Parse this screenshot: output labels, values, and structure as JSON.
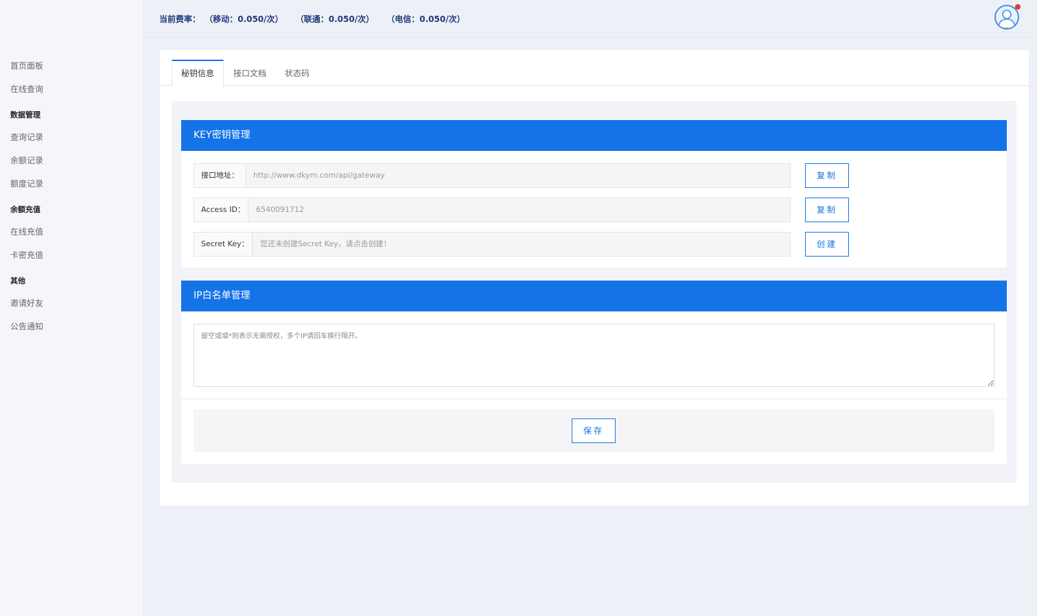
{
  "sidebar": {
    "items": [
      {
        "type": "item",
        "label": "首页面板"
      },
      {
        "type": "item",
        "label": "在线查询"
      },
      {
        "type": "group",
        "label": "数据管理"
      },
      {
        "type": "item",
        "label": "查询记录"
      },
      {
        "type": "item",
        "label": "余额记录"
      },
      {
        "type": "item",
        "label": "额度记录"
      },
      {
        "type": "group",
        "label": "余额充值"
      },
      {
        "type": "item",
        "label": "在线充值"
      },
      {
        "type": "item",
        "label": "卡密充值"
      },
      {
        "type": "group",
        "label": "其他"
      },
      {
        "type": "item",
        "label": "邀请好友"
      },
      {
        "type": "item",
        "label": "公告通知"
      }
    ]
  },
  "header": {
    "rate_title": "当前费率：",
    "rate_mobile": "（移动：0.050/次）",
    "rate_unicom": "（联通：0.050/次）",
    "rate_telecom": "（电信：0.050/次）",
    "avatar_icon": "user-avatar-icon",
    "notification_color": "#e53935"
  },
  "tabs": [
    {
      "label": "秘钥信息",
      "active": true
    },
    {
      "label": "接口文档",
      "active": false
    },
    {
      "label": "状态码",
      "active": false
    }
  ],
  "key_panel": {
    "title": "KEY密钥管理",
    "fields": [
      {
        "label": "接口地址：",
        "value": "http://www.dkym.com/api/gateway",
        "button": "复制"
      },
      {
        "label": "Access ID：",
        "value": "6540091712",
        "button": "复制"
      },
      {
        "label": "Secret Key：",
        "value": "您还未创建Secret Key，请点击创建！",
        "button": "创建"
      }
    ]
  },
  "ip_panel": {
    "title": "IP白名单管理",
    "placeholder": "留空或填*则表示无需授权，多个IP请回车换行隔开。",
    "value": "",
    "save_label": "保存"
  },
  "colors": {
    "accent": "#1473e6",
    "rate_text": "#1f3b7a"
  }
}
